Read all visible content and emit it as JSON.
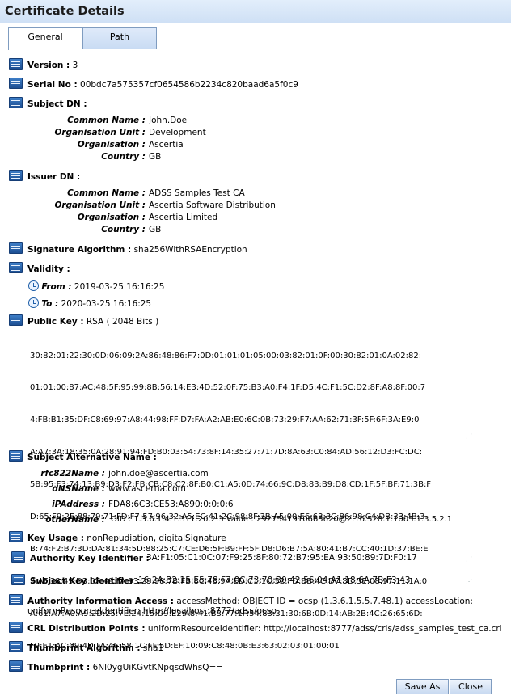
{
  "window": {
    "title": "Certificate Details"
  },
  "tabs": [
    {
      "label": "General"
    },
    {
      "label": "Path"
    }
  ],
  "fields": {
    "version": {
      "label": "Version :",
      "value": "3"
    },
    "serial": {
      "label": "Serial No :",
      "value": "00bdc7a575357cf0654586b2234c820baad6a5f0c9"
    },
    "subject_dn": {
      "label": "Subject DN :",
      "items": [
        {
          "label": "Common Name :",
          "value": "John.Doe"
        },
        {
          "label": "Organisation Unit :",
          "value": "Development"
        },
        {
          "label": "Organisation :",
          "value": "Ascertia"
        },
        {
          "label": "Country :",
          "value": "GB"
        }
      ]
    },
    "issuer_dn": {
      "label": "Issuer DN :",
      "items": [
        {
          "label": "Common Name :",
          "value": "ADSS Samples Test CA"
        },
        {
          "label": "Organisation Unit :",
          "value": "Ascertia Software Distribution"
        },
        {
          "label": "Organisation :",
          "value": "Ascertia Limited"
        },
        {
          "label": "Country :",
          "value": "GB"
        }
      ]
    },
    "signature_algorithm": {
      "label": "Signature Algorithm :",
      "value": "sha256WithRSAEncryption"
    },
    "validity": {
      "label": "Validity :",
      "from_label": "From :",
      "from_value": "2019-03-25 16:16:25",
      "to_label": "To :",
      "to_value": "2020-03-25 16:16:25"
    },
    "public_key": {
      "label": "Public Key :",
      "summary": "RSA ( 2048 Bits )",
      "lines": [
        "30:82:01:22:30:0D:06:09:2A:86:48:86:F7:0D:01:01:01:05:00:03:82:01:0F:00:30:82:01:0A:02:82:",
        "01:01:00:87:AC:48:5F:95:99:8B:56:14:E3:4D:52:0F:75:B3:A0:F4:1F:D5:4C:F1:5C:D2:8F:A8:8F:00:7",
        "4:FB:B1:35:DF:C8:69:97:A8:44:98:FF:D7:FA:A2:AB:E0:6C:0B:73:29:F7:AA:62:71:3F:5F:6F:3A:E9:0",
        "A:A7:3A:18:35:0A:28:91:94:FD:B0:03:54:73:8F:14:35:27:71:7D:8A:63:C0:84:AD:56:12:D3:FC:DC:",
        "5B:95:F3:74:13:B9:D3:F2:FB:CB:C8:C2:8F:B0:C1:A5:0D:74:66:9C:D8:83:B9:D8:CD:1F:5F:BF:71:3B:F",
        "D:65:F9:2E:88:79:71:FD:F7:57:96:32:A5:EC:41:2C:98:8F:3B:A5:00:E6:63:3C:86:98:C4:DB:33:4B:3",
        "B:74:F2:B7:3D:DA:81:34:5D:88:25:C7:CE:D6:5F:B9:FF:5F:D8:D6:B7:5A:80:41:B7:CC:40:1D:37:BE:E",
        "9:AF:38:49:D3:07:49:FA:93:29:98:7B:FB:8C:48:9A:ED:C1:1C:52:FD:BB:4C:D7:3D:5E:08:97:11:1A:0",
        "A:61:A7:A0:A9:2D:25:7E:24:15:D9:E2:A8:41:B3:77:1F:54:83:31:30:6B:0D:14:AB:2B:4C:26:65:6D:",
        "F9:E1:AC:09:4D:FA:46:58:1C:FF:5D:EF:10:09:C8:48:0B:E3:63:02:03:01:00:01"
      ]
    },
    "san": {
      "label": "Subject Alternative Name :",
      "items": [
        {
          "label": "rfc822Name :",
          "value": "john.doe@ascertia.com"
        },
        {
          "label": "dNSName :",
          "value": "www.ascertia.com"
        },
        {
          "label": "iPAddress :",
          "value": "FDA8:6C3:CE53:A890:0:0:0:6"
        },
        {
          "label": "otherName :",
          "value": "OID : 1.3.6.1.4.1.311.20.2.3   Value : 2927541910665620@2.16.528.1.1003.1.3.5.2.1"
        }
      ]
    },
    "key_usage": {
      "label": "Key Usage :",
      "value": "nonRepudiation, digitalSignature"
    },
    "authority_key_id": {
      "label": "Authority Key Identifier :",
      "value": "3A:F1:05:C1:0C:07:F9:25:8F:80:72:B7:95:EA:93:50:89:7D:F0:17"
    },
    "subject_key_id": {
      "label": "Subject Key Identifier :",
      "value": "16:2A:B2:15:E5:78:F7:0C:73:70:B0:42:56:04:A1:18:6A:7B:F3:43"
    },
    "aia": {
      "label": "Authority Information Access :",
      "line1": "accessMethod: OBJECT ID = ocsp (1.3.6.1.5.5.7.48.1) accessLocation:",
      "line2": "uniformResourceIdentifier: http://localhost:8777/adss/ocsp"
    },
    "crl": {
      "label": "CRL Distribution Points :",
      "value": "uniformResourceIdentifier: http://localhost:8777/adss/crls/adss_samples_test_ca.crl"
    },
    "thumbprint_algorithm": {
      "label": "Thumbprint Algorithm :",
      "value": "sha1"
    },
    "thumbprint": {
      "label": "Thumbprint :",
      "value": "6Nl0ygUiKGvtKNpqsdWhsQ=="
    }
  },
  "buttons": {
    "save_as": "Save As",
    "close": "Close"
  }
}
